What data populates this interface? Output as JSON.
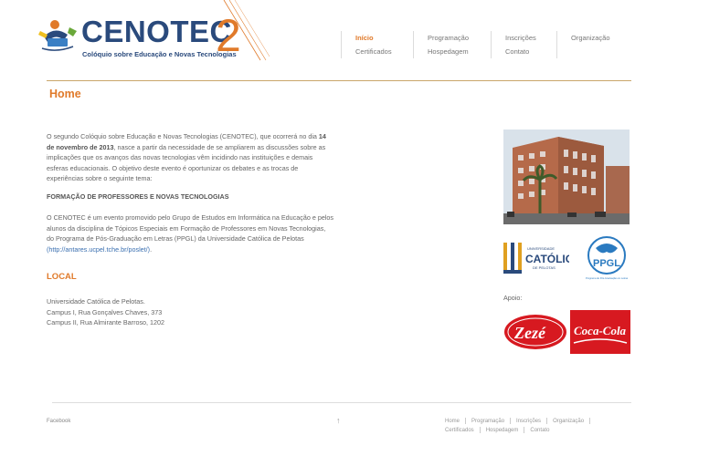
{
  "logo": {
    "main": "CENOTEC",
    "edition": "2",
    "subtitle": "Colóquio sobre Educação e Novas Tecnologias"
  },
  "nav": {
    "col1": [
      "Início",
      "Certificados"
    ],
    "col2": [
      "Programação",
      "Hospedagem"
    ],
    "col3": [
      "Inscrições",
      "Contato"
    ],
    "col4": [
      "Organização"
    ]
  },
  "page_title": "Home",
  "content": {
    "p1_a": "O segundo Colóquio sobre Educação e Novas Tecnologias (CENOTEC), que ocorrerá no dia ",
    "p1_date": "14 de novembro de 2013",
    "p1_b": ", nasce a partir da necessidade de se ampliarem as discussões sobre as implicações que os avanços das novas tecnologias vêm incidindo nas instituições e demais esferas educacionais. O objetivo deste evento é oportunizar os debates e as trocas de experiências sobre o seguinte tema:",
    "theme": "FORMAÇÃO DE PROFESSORES E NOVAS TECNOLOGIAS",
    "p2_a": "O CENOTEC é um evento promovido pelo Grupo de Estudos em Informática na Educação e pelos alunos da disciplina de Tópicos Especiais em Formação de Professores em Novas Tecnologias, do Programa de Pós-Graduação em Letras (PPGL) da Universidade Católica de Pelotas ",
    "p2_link": "(http://antares.ucpel.tche.br/poslet/)",
    "p2_end": "."
  },
  "local": {
    "title": "LOCAL",
    "line1": "Universidade Católica de Pelotas.",
    "line2": "Campus I, Rua Gonçalves Chaves, 373",
    "line3": "Campus II, Rua Almirante Barroso, 1202"
  },
  "sidebar": {
    "apoio_label": "Apoio:",
    "catolica_top": "UNIVERSIDADE",
    "catolica_name": "CATÓLICA",
    "catolica_city": "DE PELOTAS",
    "ppgl": "PPGL",
    "ppgl_sub": "Programa de Pós-Graduação em Letras",
    "zeze": "Zezé",
    "coca": "Coca-Cola"
  },
  "footer": {
    "facebook": "Facebook",
    "up_arrow": "↑",
    "row1": [
      "Home",
      "Programação",
      "Inscrições",
      "Organização"
    ],
    "row2": [
      "Certificados",
      "Hospedagem",
      "Contato"
    ]
  },
  "colors": {
    "accent": "#e07a2a",
    "brand_blue": "#2a4a7c",
    "link": "#3a6fb0",
    "rule": "#c9a66a"
  }
}
